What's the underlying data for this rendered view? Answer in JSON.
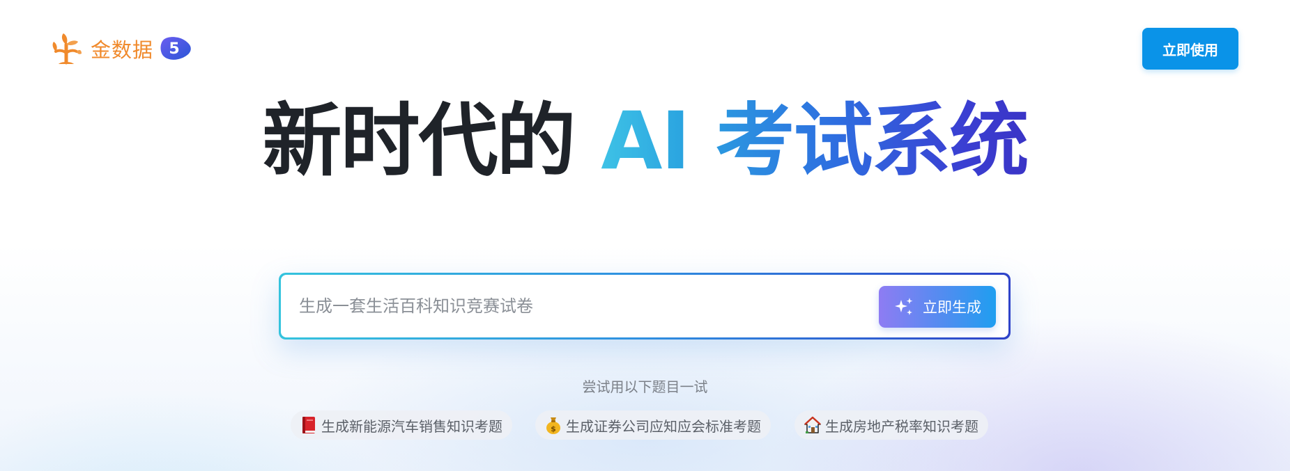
{
  "header": {
    "logo_text": "金数据",
    "badge_text": "5",
    "cta_label": "立即使用"
  },
  "hero": {
    "part1": "新时代的",
    "part2": "AI 考试系统"
  },
  "search": {
    "placeholder": "生成一套生活百科知识竞赛试卷",
    "value": "",
    "generate_label": "立即生成"
  },
  "suggestions": {
    "label": "尝试用以下题目一试",
    "items": [
      {
        "icon": "book-icon",
        "text": "生成新能源汽车销售知识考题"
      },
      {
        "icon": "money-bag-icon",
        "text": "生成证券公司应知应会标准考题"
      },
      {
        "icon": "house-icon",
        "text": "生成房地产税率知识考题"
      }
    ]
  },
  "colors": {
    "logo_orange": "#f08a2c",
    "cta_blue": "#0a93e8",
    "hero_dark": "#1f2329",
    "hero_gradient_start": "#3ec2e6",
    "hero_gradient_end": "#3a34c6"
  }
}
